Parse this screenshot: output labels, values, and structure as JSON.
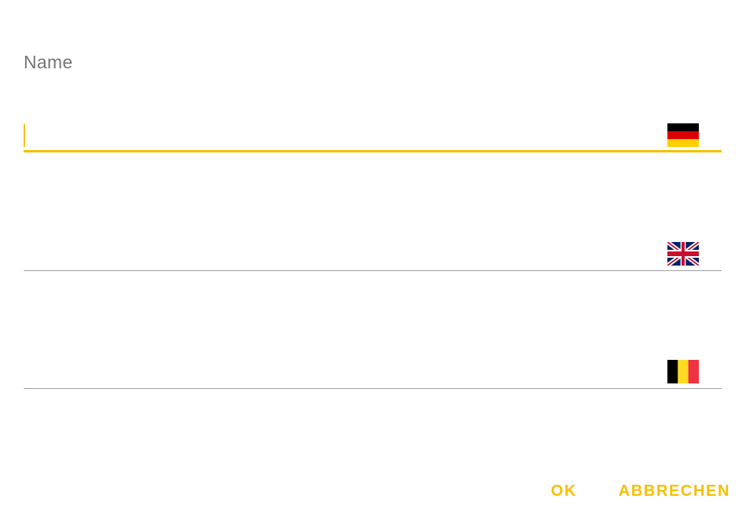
{
  "dialog": {
    "title": "Name",
    "accent_color": "#f5c000",
    "fields": [
      {
        "language_flag": "germany-flag-icon",
        "value": "",
        "placeholder": "",
        "focused": true
      },
      {
        "language_flag": "uk-flag-icon",
        "value": "",
        "placeholder": "",
        "focused": false
      },
      {
        "language_flag": "belgium-flag-icon",
        "value": "",
        "placeholder": "",
        "focused": false
      }
    ],
    "actions": {
      "ok_label": "OK",
      "cancel_label": "ABBRECHEN"
    }
  }
}
